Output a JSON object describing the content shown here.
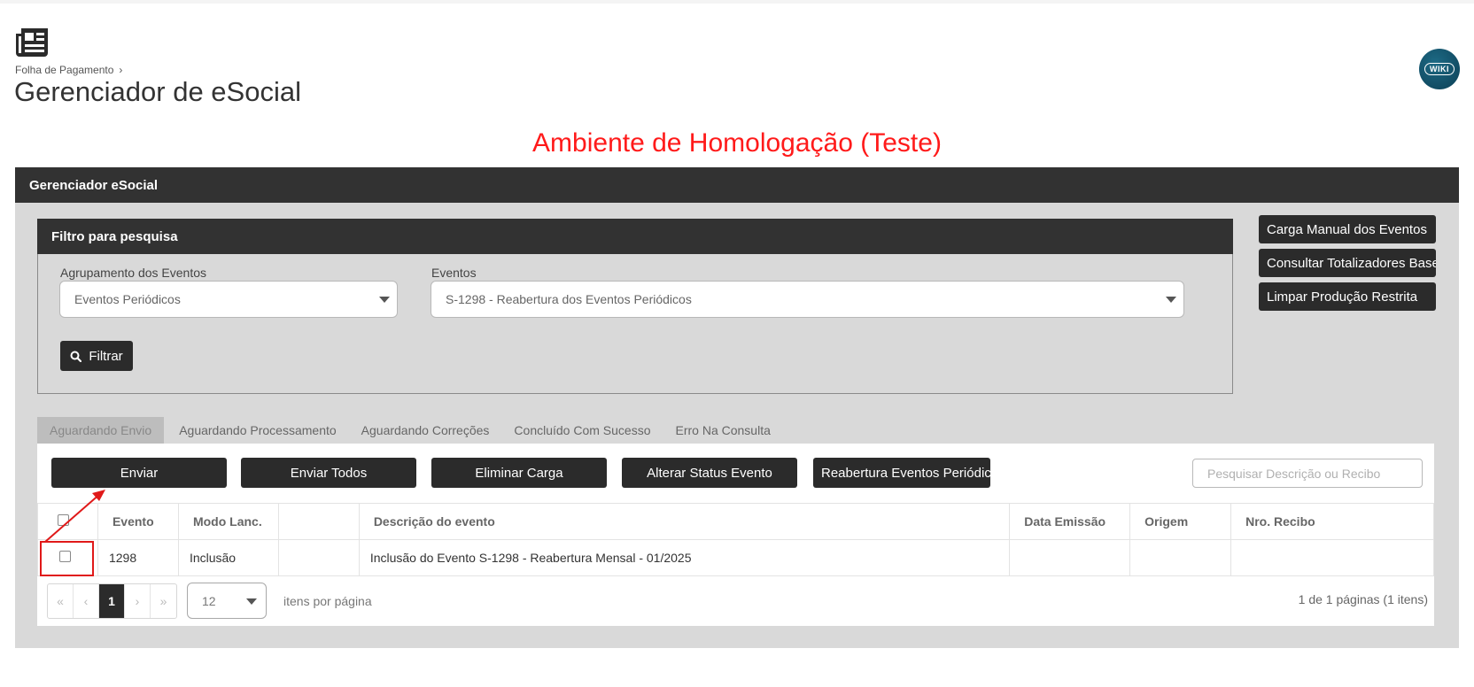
{
  "header": {
    "breadcrumb": "Folha de Pagamento",
    "title": "Gerenciador de eSocial",
    "wiki_label": "WIKI"
  },
  "environment_banner": "Ambiente de Homologação (Teste)",
  "panel": {
    "title": "Gerenciador eSocial"
  },
  "filter": {
    "title": "Filtro para pesquisa",
    "grouping_label": "Agrupamento dos Eventos",
    "grouping_value": "Eventos Periódicos",
    "events_label": "Eventos",
    "events_value": "S-1298 - Reabertura dos Eventos Periódicos",
    "filter_button": "Filtrar"
  },
  "side_actions": [
    "Carga Manual dos Eventos",
    "Consultar Totalizadores Base",
    "Limpar Produção Restrita"
  ],
  "tabs": [
    "Aguardando Envio",
    "Aguardando Processamento",
    "Aguardando Correções",
    "Concluído Com Sucesso",
    "Erro Na Consulta"
  ],
  "actions": [
    "Enviar",
    "Enviar Todos",
    "Eliminar Carga",
    "Alterar Status Evento",
    "Reabertura Eventos Periódic"
  ],
  "search": {
    "placeholder": "Pesquisar Descrição ou Recibo"
  },
  "table": {
    "columns": [
      "Evento",
      "Modo Lanc.",
      "",
      "Descrição do evento",
      "Data Emissão",
      "Origem",
      "Nro. Recibo"
    ],
    "rows": [
      [
        "1298",
        "Inclusão",
        "",
        "Inclusão do Evento S-1298 - Reabertura Mensal - 01/2025",
        "",
        "",
        ""
      ]
    ]
  },
  "pagination": {
    "first": "«",
    "prev": "‹",
    "current": "1",
    "next": "›",
    "last": "»",
    "page_size": "12",
    "per_page_label": "itens por página",
    "info": "1 de 1 páginas (1 itens)"
  },
  "colors": {
    "dark": "#323232",
    "panel_bg": "#d9d9d9",
    "banner_red": "#ff1a1a",
    "annotation_red": "#e01919"
  }
}
